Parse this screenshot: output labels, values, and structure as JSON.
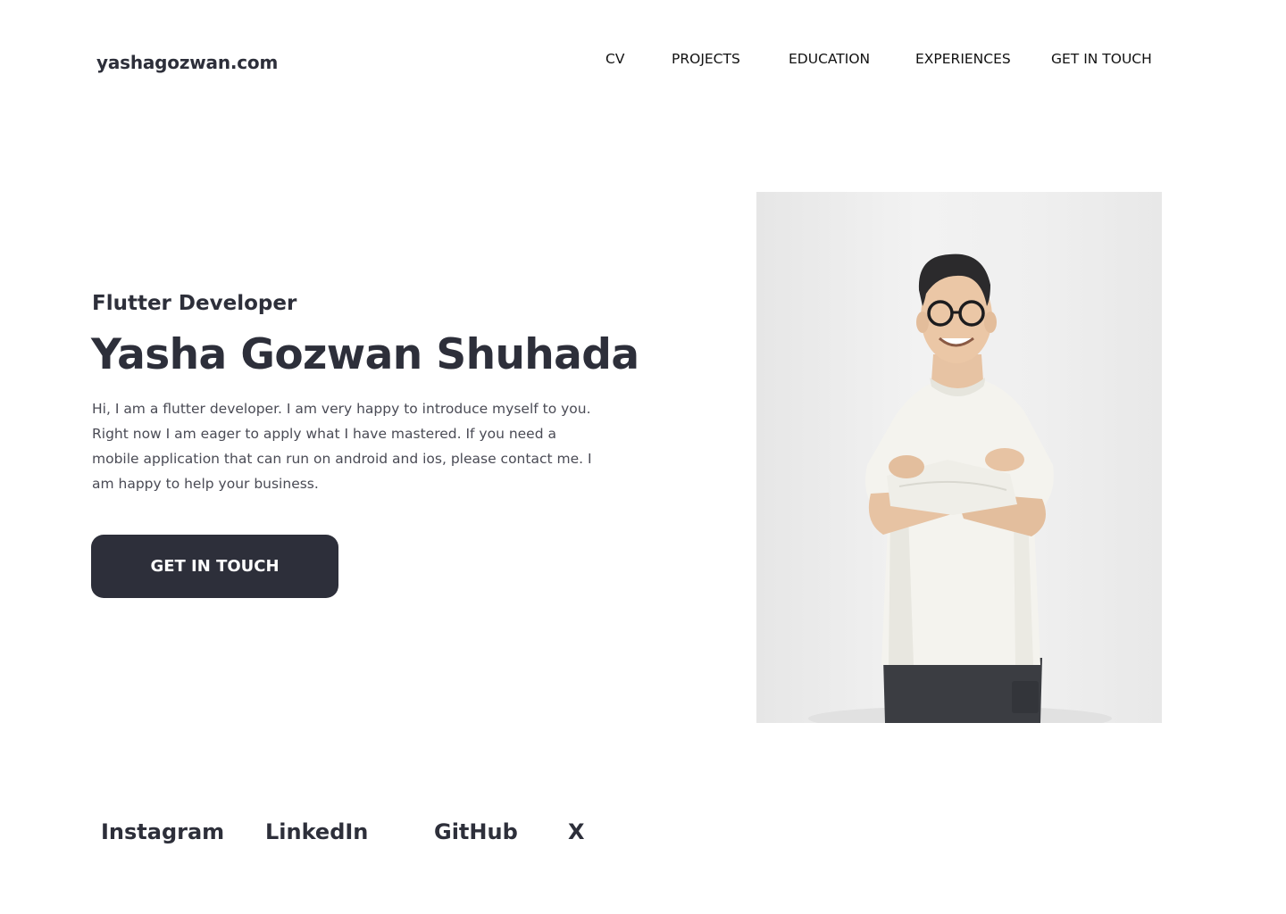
{
  "header": {
    "logo": "yashagozwan.com",
    "nav": [
      "CV",
      "PROJECTS",
      "EDUCATION",
      "EXPERIENCES",
      "GET IN TOUCH"
    ]
  },
  "hero": {
    "role": "Flutter Developer",
    "name": "Yasha Gozwan Shuhada",
    "intro": "Hi, I am a flutter developer. I am very happy to introduce myself to you. Right now I am eager to apply what I have mastered. If you need a mobile application that can run on android and ios, please contact me. I am happy to help your business.",
    "cta": "GET IN TOUCH"
  },
  "social": [
    "Instagram",
    "LinkedIn",
    "GitHub",
    "X"
  ],
  "colors": {
    "primary": "#2d2f3a",
    "background": "#ffffff",
    "text_muted": "#4a4b55"
  }
}
